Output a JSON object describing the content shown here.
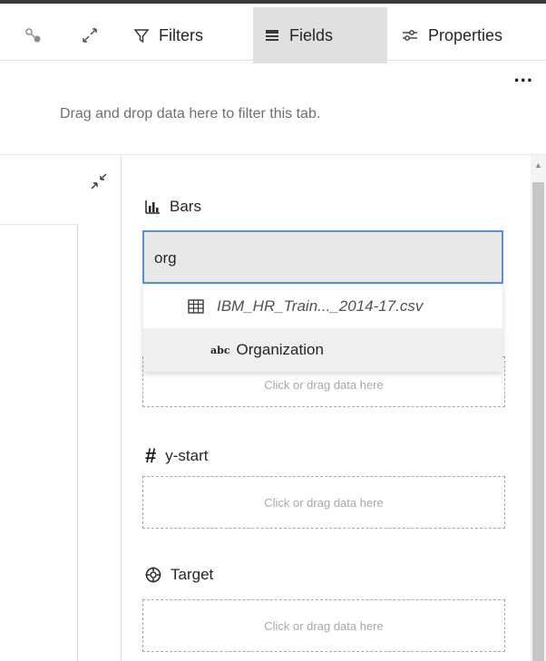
{
  "toolbar": {
    "filters_label": "Filters",
    "fields_label": "Fields",
    "properties_label": "Properties",
    "more_label": "..."
  },
  "filter_area": {
    "hint": "Drag and drop data here to filter this tab."
  },
  "fields_panel": {
    "bars": {
      "label": "Bars",
      "search_value": "org",
      "dropdown": {
        "file_name": "IBM_HR_Train..._2014-17.csv",
        "field_type": "abc",
        "field_name": "Organization"
      },
      "drop_hint": "Click or drag data here"
    },
    "y_start": {
      "label": "y-start",
      "drop_hint": "Click or drag data here"
    },
    "target": {
      "label": "Target",
      "drop_hint": "Click or drag data here"
    }
  },
  "colors": {
    "accent_border": "#5b8fd6",
    "active_tab_bg": "#e0e0e0"
  },
  "icons": [
    "connect-icon",
    "expand-icon",
    "filter-icon",
    "fields-icon",
    "properties-icon",
    "collapse-icon",
    "bar-chart-icon",
    "table-icon",
    "hash-icon",
    "target-icon"
  ]
}
